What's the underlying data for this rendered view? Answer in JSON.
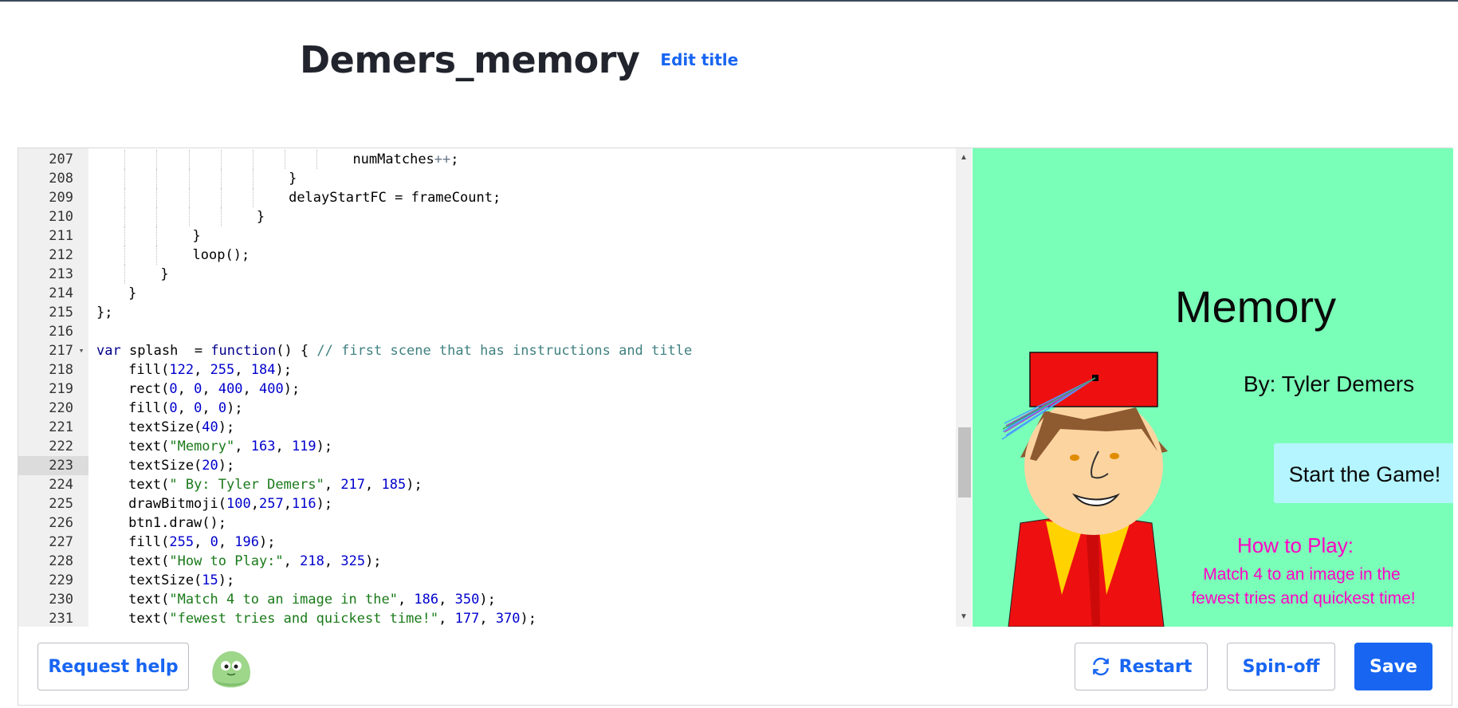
{
  "page": {
    "title": "Demers_memory",
    "edit_title_label": "Edit title"
  },
  "editor": {
    "active_line": 223,
    "lines": [
      {
        "n": "207",
        "indent": 8
      },
      {
        "n": "208",
        "indent": 6
      },
      {
        "n": "209",
        "indent": 6
      },
      {
        "n": "210",
        "indent": 5
      },
      {
        "n": "211",
        "indent": 3
      },
      {
        "n": "212",
        "indent": 3
      },
      {
        "n": "213",
        "indent": 2
      },
      {
        "n": "214",
        "indent": 1
      },
      {
        "n": "215",
        "indent": 0
      },
      {
        "n": "216",
        "indent": 0
      },
      {
        "n": "217",
        "indent": 0,
        "fold": true
      },
      {
        "n": "218",
        "indent": 1
      },
      {
        "n": "219",
        "indent": 1
      },
      {
        "n": "220",
        "indent": 1
      },
      {
        "n": "221",
        "indent": 1
      },
      {
        "n": "222",
        "indent": 1
      },
      {
        "n": "223",
        "indent": 1
      },
      {
        "n": "224",
        "indent": 1
      },
      {
        "n": "225",
        "indent": 1
      },
      {
        "n": "226",
        "indent": 1
      },
      {
        "n": "227",
        "indent": 1
      },
      {
        "n": "228",
        "indent": 1
      },
      {
        "n": "229",
        "indent": 1
      },
      {
        "n": "230",
        "indent": 1
      },
      {
        "n": "231",
        "indent": 1
      }
    ],
    "code": [
      [
        [
          "t",
          "numMatches"
        ],
        [
          "o",
          "++"
        ],
        [
          "t",
          ";"
        ]
      ],
      [
        [
          "t",
          "}"
        ]
      ],
      [
        [
          "t",
          "delayStartFC = frameCount;"
        ]
      ],
      [
        [
          "t",
          "}"
        ]
      ],
      [
        [
          "t",
          "}"
        ]
      ],
      [
        [
          "t",
          "loop();"
        ]
      ],
      [
        [
          "t",
          "}"
        ]
      ],
      [
        [
          "t",
          "}"
        ]
      ],
      [
        [
          "t",
          "};"
        ]
      ],
      [],
      [
        [
          "k",
          "var"
        ],
        [
          "t",
          " splash  = "
        ],
        [
          "k",
          "function"
        ],
        [
          "t",
          "() { "
        ],
        [
          "c",
          "// first scene that has instructions and title"
        ]
      ],
      [
        [
          "t",
          "fill("
        ],
        [
          "n",
          "122"
        ],
        [
          "t",
          ", "
        ],
        [
          "n",
          "255"
        ],
        [
          "t",
          ", "
        ],
        [
          "n",
          "184"
        ],
        [
          "t",
          ");"
        ]
      ],
      [
        [
          "t",
          "rect("
        ],
        [
          "n",
          "0"
        ],
        [
          "t",
          ", "
        ],
        [
          "n",
          "0"
        ],
        [
          "t",
          ", "
        ],
        [
          "n",
          "400"
        ],
        [
          "t",
          ", "
        ],
        [
          "n",
          "400"
        ],
        [
          "t",
          ");"
        ]
      ],
      [
        [
          "t",
          "fill("
        ],
        [
          "n",
          "0"
        ],
        [
          "t",
          ", "
        ],
        [
          "n",
          "0"
        ],
        [
          "t",
          ", "
        ],
        [
          "n",
          "0"
        ],
        [
          "t",
          ");"
        ]
      ],
      [
        [
          "t",
          "textSize("
        ],
        [
          "n",
          "40"
        ],
        [
          "t",
          ");"
        ]
      ],
      [
        [
          "t",
          "text("
        ],
        [
          "s",
          "\"Memory\""
        ],
        [
          "t",
          ", "
        ],
        [
          "n",
          "163"
        ],
        [
          "t",
          ", "
        ],
        [
          "n",
          "119"
        ],
        [
          "t",
          ");"
        ]
      ],
      [
        [
          "t",
          "textSize("
        ],
        [
          "n",
          "20"
        ],
        [
          "t",
          ");"
        ]
      ],
      [
        [
          "t",
          "text("
        ],
        [
          "s",
          "\" By: Tyler Demers\""
        ],
        [
          "t",
          ", "
        ],
        [
          "n",
          "217"
        ],
        [
          "t",
          ", "
        ],
        [
          "n",
          "185"
        ],
        [
          "t",
          ");"
        ]
      ],
      [
        [
          "t",
          "drawBitmoji("
        ],
        [
          "n",
          "100"
        ],
        [
          "t",
          ","
        ],
        [
          "n",
          "257"
        ],
        [
          "t",
          ","
        ],
        [
          "n",
          "116"
        ],
        [
          "t",
          ");"
        ]
      ],
      [
        [
          "t",
          "btn1.draw();"
        ]
      ],
      [
        [
          "t",
          "fill("
        ],
        [
          "n",
          "255"
        ],
        [
          "t",
          ", "
        ],
        [
          "n",
          "0"
        ],
        [
          "t",
          ", "
        ],
        [
          "n",
          "196"
        ],
        [
          "t",
          ");"
        ]
      ],
      [
        [
          "t",
          "text("
        ],
        [
          "s",
          "\"How to Play:\""
        ],
        [
          "t",
          ", "
        ],
        [
          "n",
          "218"
        ],
        [
          "t",
          ", "
        ],
        [
          "n",
          "325"
        ],
        [
          "t",
          ");"
        ]
      ],
      [
        [
          "t",
          "textSize("
        ],
        [
          "n",
          "15"
        ],
        [
          "t",
          ");"
        ]
      ],
      [
        [
          "t",
          "text("
        ],
        [
          "s",
          "\"Match 4 to an image in the\""
        ],
        [
          "t",
          ", "
        ],
        [
          "n",
          "186"
        ],
        [
          "t",
          ", "
        ],
        [
          "n",
          "350"
        ],
        [
          "t",
          ");"
        ]
      ],
      [
        [
          "t",
          "text("
        ],
        [
          "s",
          "\"fewest tries and quickest time!\""
        ],
        [
          "t",
          ", "
        ],
        [
          "n",
          "177"
        ],
        [
          "t",
          ", "
        ],
        [
          "n",
          "370"
        ],
        [
          "t",
          ");"
        ]
      ]
    ]
  },
  "canvas": {
    "background": "#7affb8",
    "title": "Memory",
    "byline": "By: Tyler Demers",
    "start_button": "Start the Game!",
    "how_to_heading": "How to Play:",
    "how_to_line1": "Match 4 to an image in the",
    "how_to_line2": "fewest tries and quickest time!",
    "accent_color": "#ff00c4"
  },
  "footer": {
    "request_help_label": "Request help",
    "restart_label": "Restart",
    "spinoff_label": "Spin-off",
    "save_label": "Save"
  },
  "colors": {
    "brand_blue": "#1865f2"
  }
}
